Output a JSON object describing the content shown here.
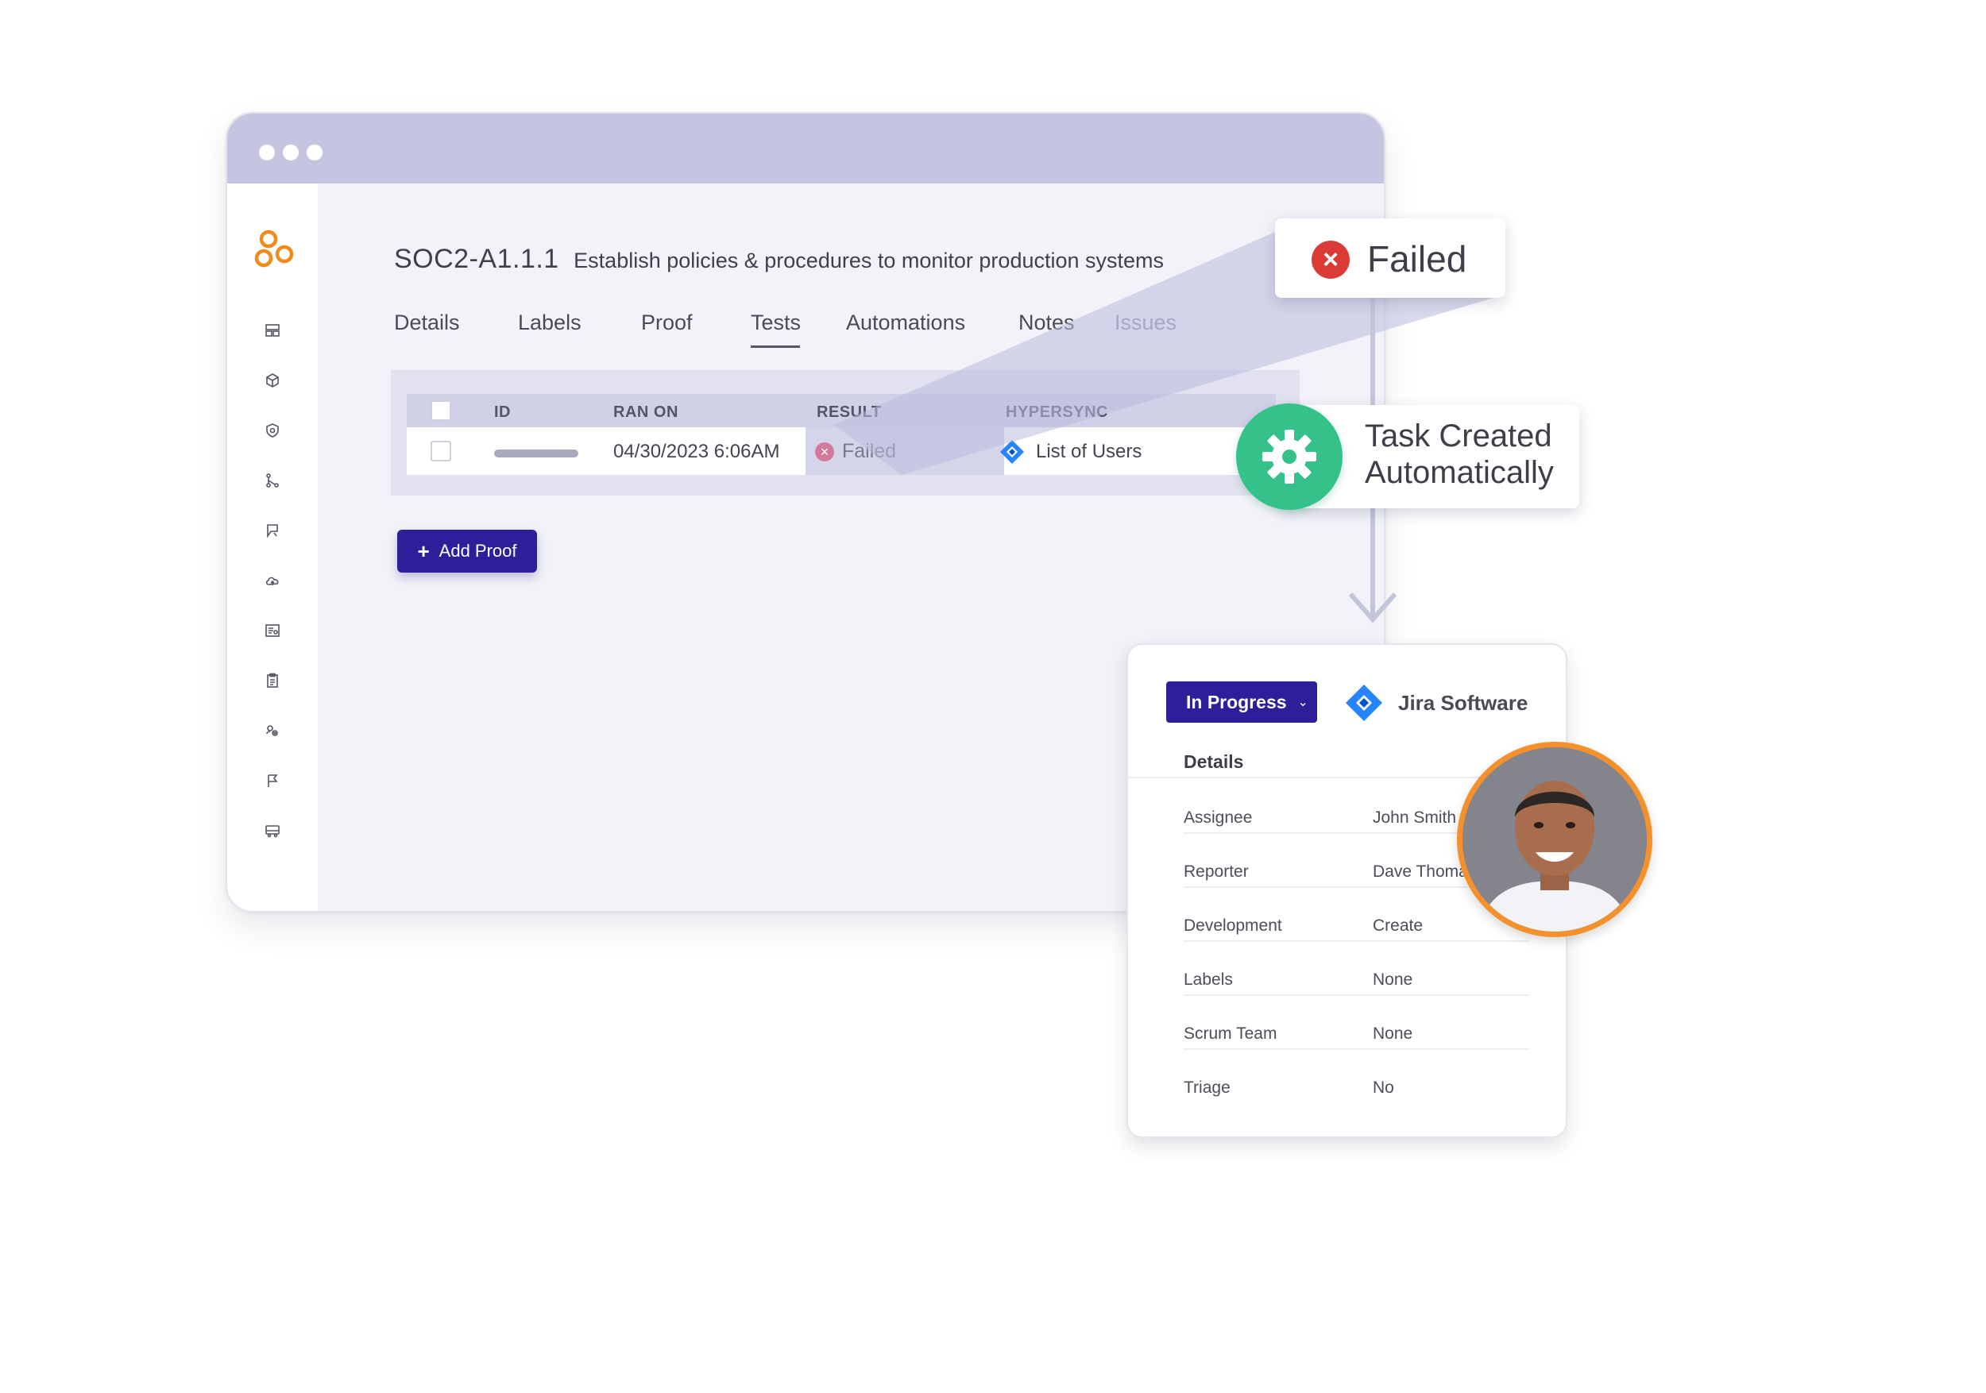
{
  "control": {
    "id": "SOC2-A1.1.1",
    "description": "Establish policies & procedures to monitor production systems"
  },
  "tabs": [
    {
      "label": "Details"
    },
    {
      "label": "Labels"
    },
    {
      "label": "Proof"
    },
    {
      "label": "Tests",
      "active": true
    },
    {
      "label": "Automations"
    },
    {
      "label": "Notes"
    },
    {
      "label": "Issues"
    }
  ],
  "table": {
    "columns": [
      "ID",
      "RAN ON",
      "RESULT",
      "HYPERSYNC"
    ],
    "rows": [
      {
        "ran_on": "04/30/2023 6:06AM",
        "result": "Failed",
        "hypersync": "List of Users"
      }
    ]
  },
  "add_proof_label": "Add Proof",
  "failed_callout": {
    "label": "Failed",
    "color": "#db3b36"
  },
  "task_callout": {
    "line1": "Task Created",
    "line2": "Automatically",
    "color": "#34c28a"
  },
  "jira_card": {
    "status": "In Progress",
    "product": "Jira Software",
    "section_title": "Details",
    "fields": [
      {
        "label": "Assignee",
        "value": "John Smith"
      },
      {
        "label": "Reporter",
        "value": "Dave Thomas"
      },
      {
        "label": "Development",
        "value": "Create"
      },
      {
        "label": "Labels",
        "value": "None"
      },
      {
        "label": "Scrum Team",
        "value": "None"
      },
      {
        "label": "Triage",
        "value": "No"
      }
    ]
  },
  "sidebar_icons": [
    "dashboard-icon",
    "box-icon",
    "shield-icon",
    "workflow-icon",
    "bookmark-icon",
    "cloud-icon",
    "report-icon",
    "clipboard-icon",
    "settings-group-icon",
    "flag-icon",
    "bus-icon"
  ],
  "colors": {
    "accent": "#2d1f99",
    "logo": "#f08a1a",
    "titlebar": "#c5c5e2",
    "avatar_ring": "#f5912d",
    "jira_blue": "#2684ff"
  }
}
